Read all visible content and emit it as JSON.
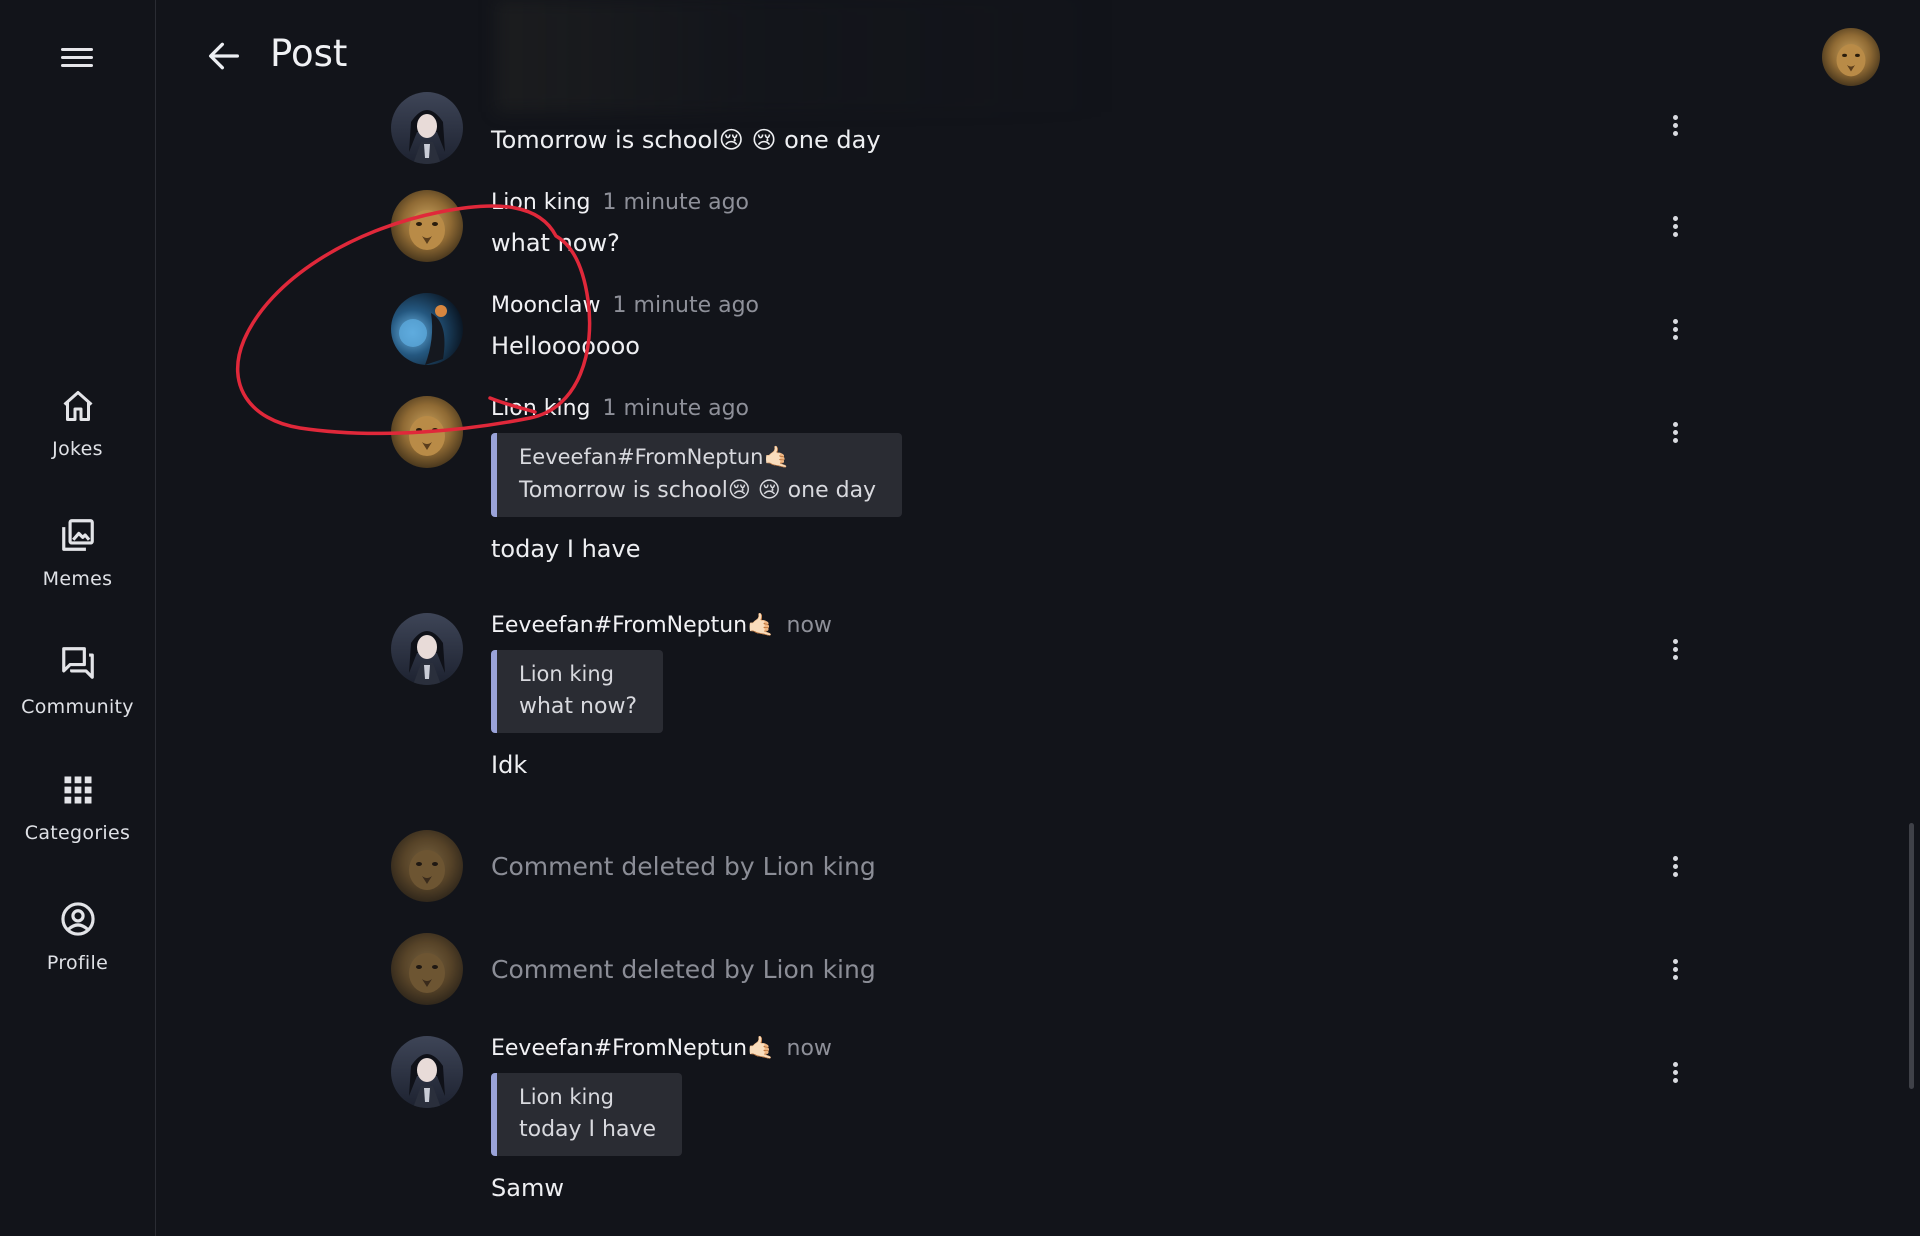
{
  "sidebar": {
    "items": [
      {
        "label": "Jokes",
        "icon": "home-icon"
      },
      {
        "label": "Memes",
        "icon": "image-gallery-icon"
      },
      {
        "label": "Community",
        "icon": "forum-icon"
      },
      {
        "label": "Categories",
        "icon": "grid-icon"
      },
      {
        "label": "Profile",
        "icon": "account-circle-icon"
      }
    ]
  },
  "header": {
    "title": "Post",
    "back_icon": "arrow-left-icon",
    "avatar_icon": "lion-avatar"
  },
  "comments": [
    {
      "author": "",
      "time": "",
      "text": "Tomorrow is school😢 😢 one day",
      "avatar": "anime-avatar"
    },
    {
      "author": "Lion king",
      "time": "1 minute ago",
      "text": "what now?",
      "avatar": "lion-avatar"
    },
    {
      "author": "Moonclaw",
      "time": "1 minute ago",
      "text": "Hellooooooo",
      "avatar": "moon-avatar"
    },
    {
      "author": "Lion king",
      "time": "1 minute ago",
      "quote_author": "Eeveefan#FromNeptun🤙🏻",
      "quote_text": "Tomorrow is school😢 😢 one day",
      "text": "today I have",
      "avatar": "lion-avatar"
    },
    {
      "author": "Eeveefan#FromNeptun🤙🏻",
      "time": "now",
      "quote_author": "Lion king",
      "quote_text": "what now?",
      "text": "Idk",
      "avatar": "anime-avatar"
    },
    {
      "deleted_text": "Comment deleted by Lion king",
      "avatar": "lion-avatar"
    },
    {
      "deleted_text": "Comment deleted by Lion king",
      "avatar": "lion-avatar"
    },
    {
      "author": "Eeveefan#FromNeptun🤙🏻",
      "time": "now",
      "quote_author": "Lion king",
      "quote_text": "today I have",
      "text": "Samw",
      "avatar": "anime-avatar"
    }
  ],
  "colors": {
    "background": "#12141a",
    "quote_background": "#2a2c33",
    "quote_accent": "#9aa3d9",
    "annotation_red": "#e0283a",
    "muted_text": "#8e9099"
  }
}
